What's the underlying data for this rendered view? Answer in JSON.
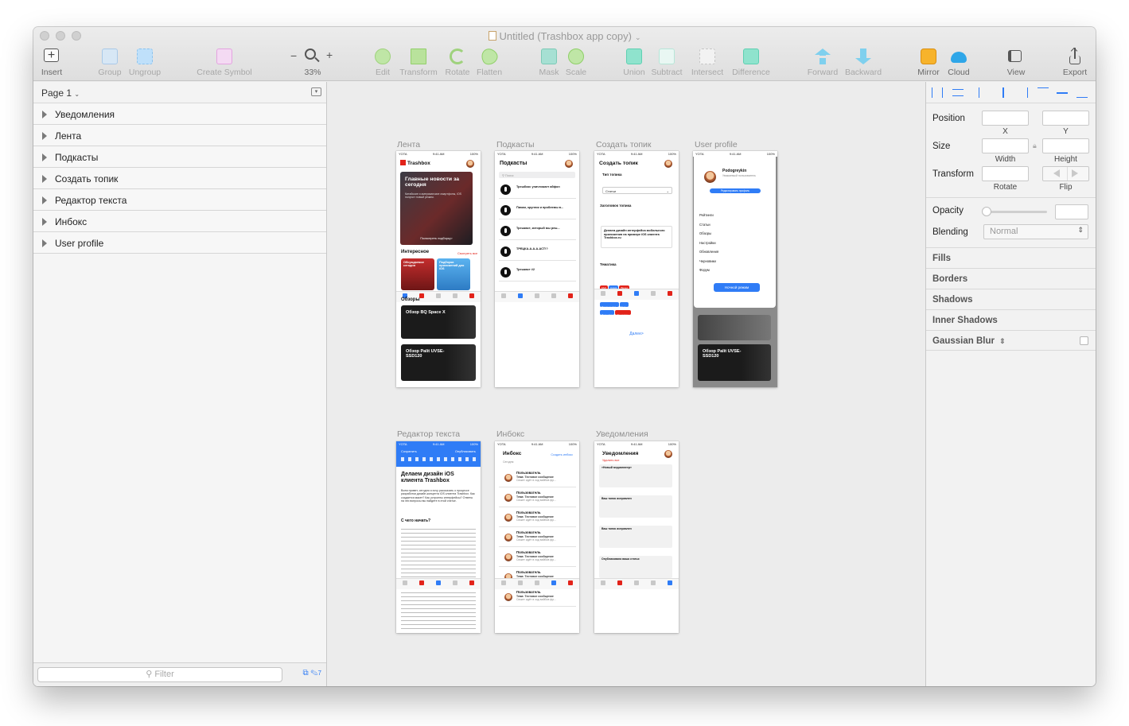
{
  "window": {
    "title": "Untitled (Trashbox app copy)"
  },
  "toolbar": {
    "insert": "Insert",
    "group": "Group",
    "ungroup": "Ungroup",
    "create_symbol": "Create Symbol",
    "zoom_minus": "−",
    "zoom_plus": "+",
    "zoom_value": "33%",
    "edit": "Edit",
    "transform": "Transform",
    "rotate": "Rotate",
    "flatten": "Flatten",
    "mask": "Mask",
    "scale": "Scale",
    "union": "Union",
    "subtract": "Subtract",
    "intersect": "Intersect",
    "difference": "Difference",
    "forward": "Forward",
    "backward": "Backward",
    "mirror": "Mirror",
    "cloud": "Cloud",
    "view": "View",
    "export": "Export"
  },
  "left_panel": {
    "page": "Page 1",
    "layers": [
      "Уведомления",
      "Лента",
      "Подкасты",
      "Создать топик",
      "Редактор текста",
      "Инбокс",
      "User profile"
    ],
    "filter_placeholder": "Filter",
    "filter_count": "7"
  },
  "artboards": {
    "lenta": {
      "name": "Лента",
      "status": {
        "carrier": "YOTA",
        "time": "9:41 AM",
        "battery": "100%"
      },
      "brand": "Trashbox",
      "hero_title": "Главные новости за сегодня",
      "hero_text": "Китайские и американские смартфоны, iOS получит новый режим.",
      "hero_link": "Посмотреть подборку>",
      "interesting": "Интересное",
      "see_all": "Смотреть все",
      "card1": "Обсуждаемое сегодня",
      "card2": "Подборка приложений для iOS",
      "reviews": "Обзоры",
      "review1": "Обзор BQ Space X",
      "review2": "Обзор Palit UVSE-SSD120"
    },
    "podcasts": {
      "name": "Подкасты",
      "title": "Подкасты",
      "search": "Поиск",
      "items": [
        "Трешбокс уничтожает айфон",
        "Пиком, круглик и проблемы в...",
        "Трешкаст, который мы реш...",
        "ТРЕЦКА-А-А-А-АСТ!?",
        "Трешкаст #2"
      ]
    },
    "create_topic": {
      "name": "Создать топик",
      "title": "Создать топик",
      "type_label": "Тип топика",
      "type_value": "Статьи",
      "header_label": "Заголовок топика",
      "header_value": "Делаем дизайн интерфейса мобильного приложения на примере iOS клиента Trashbox.ru",
      "theme_label": "Тематика",
      "tags": [
        "FAQ",
        "Аудио",
        "Видео",
        "Обзоры",
        "Пресс-релизы",
        "Темы",
        "Прошивка",
        "Программы"
      ],
      "next": "Далее>"
    },
    "user_profile": {
      "name": "User profile",
      "username": "Podogreykin",
      "role": "Уважаемый пользователь",
      "edit_btn": "Редактировать профиль",
      "menu": [
        "Рейтинги",
        "Статьи",
        "Обзоры",
        "Настройки",
        "Обновления",
        "Черновики",
        "Форум"
      ],
      "night_btn": "Ночной режим",
      "review2": "Обзор Palit UVSE-SSD120"
    },
    "editor": {
      "name": "Редактор текста",
      "cancel": "Сохранить",
      "publish": "Опубликовать",
      "title": "Делаем дизайн iOS клиента Trashbox",
      "subtitle": "С чего начать?",
      "body": "Всем привет, сегодня я хочу рассказать о процессе разработки дизайн-концепта iOS клиента Trashbox. Как создается макет? Как устроены интерфейсы? Ответы на эти вопросы вы найдете в этой статье."
    },
    "inbox": {
      "name": "Инбокс",
      "title": "Инбокс",
      "action": "Создать инбокс",
      "today": "Сегодня",
      "sender": "Пользователь",
      "subject": "Тема: Тестовое сообщение",
      "preview": "Сюжет идёт в ход вайбов фр..."
    },
    "notifications": {
      "name": "Уведомления",
      "title": "Уведомления",
      "clear": "Удалить все",
      "items": [
        "«Новый медиаплеер»",
        "Ваш топик исправлен",
        "Ваш топик исправлен",
        "Опубликована ваша статья"
      ]
    }
  },
  "inspector": {
    "position": "Position",
    "x": "X",
    "y": "Y",
    "size": "Size",
    "width": "Width",
    "height": "Height",
    "transform": "Transform",
    "rotate": "Rotate",
    "flip": "Flip",
    "opacity": "Opacity",
    "blending": "Blending",
    "blending_value": "Normal",
    "sections": [
      "Fills",
      "Borders",
      "Shadows",
      "Inner Shadows",
      "Gaussian Blur"
    ]
  },
  "colors": {
    "accent": "#2f7cf6",
    "trashbox_red": "#e2231a",
    "toolbar_disabled": "#a8a8a8",
    "canvas_bg": "#ececec"
  }
}
